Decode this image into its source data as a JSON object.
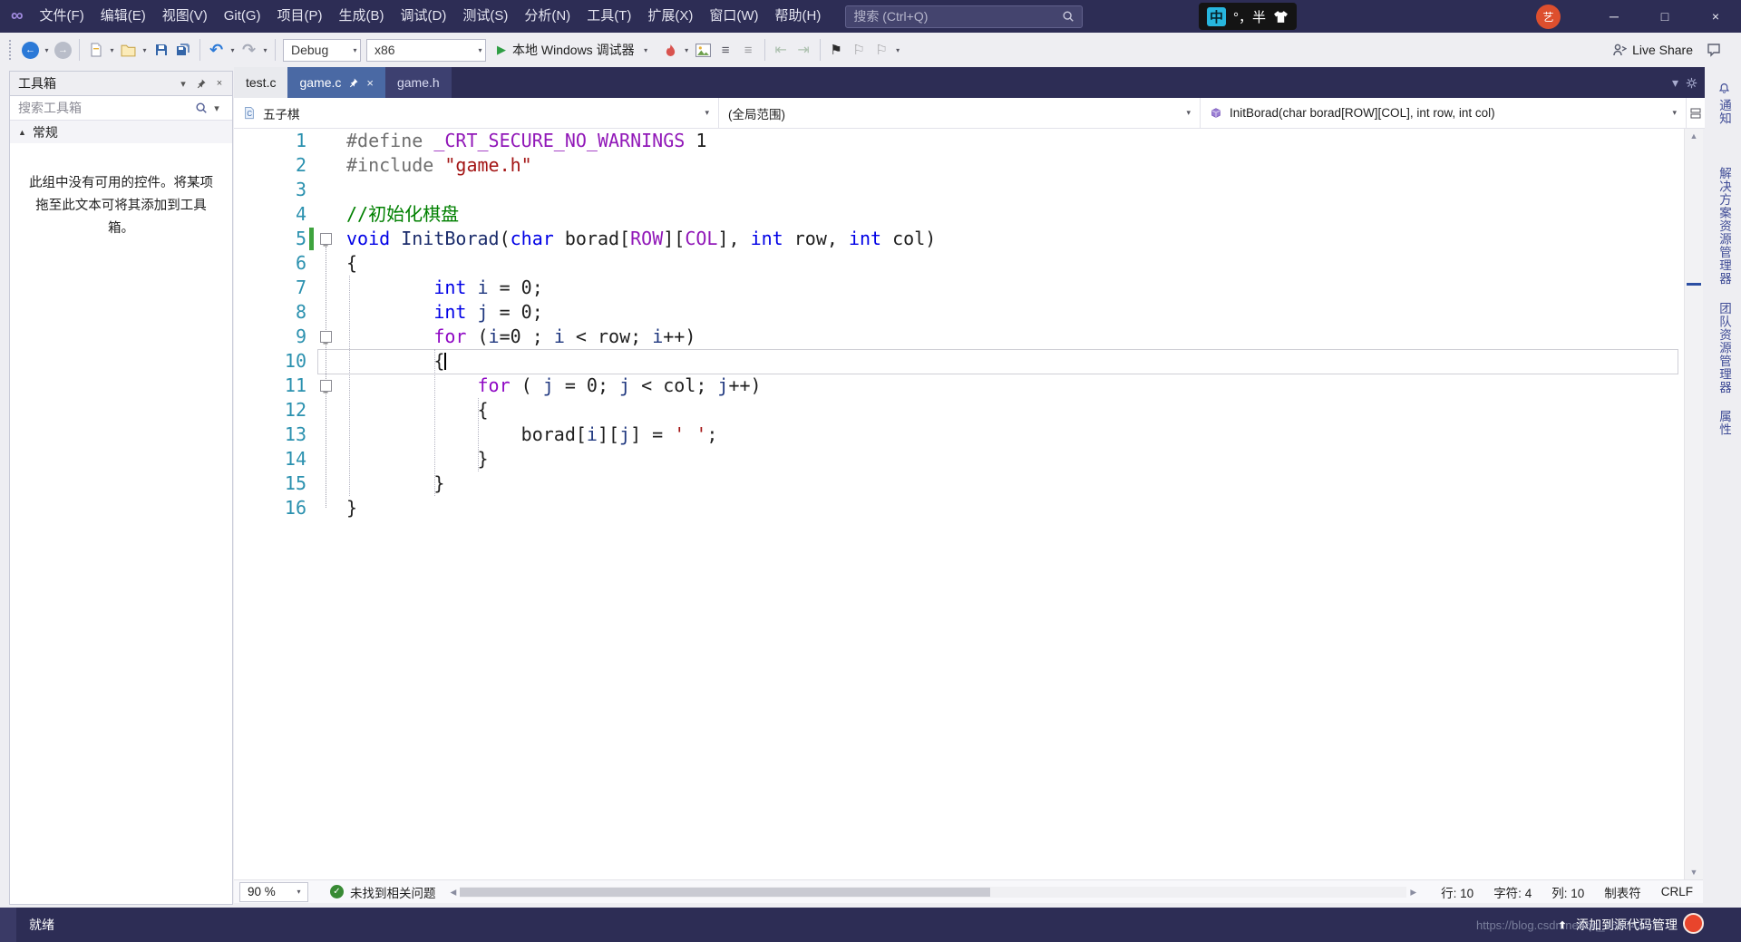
{
  "window": {
    "menu": [
      "文件(F)",
      "编辑(E)",
      "视图(V)",
      "Git(G)",
      "项目(P)",
      "生成(B)",
      "调试(D)",
      "测试(S)",
      "分析(N)",
      "工具(T)",
      "扩展(X)",
      "窗口(W)",
      "帮助(H)"
    ],
    "search_placeholder": "搜索 (Ctrl+Q)",
    "ime_lang": "中",
    "ime_mode": "°，半",
    "avatar": "艺",
    "controls": {
      "min": "─",
      "max": "□",
      "close": "×"
    }
  },
  "glyphs": {
    "dropdown": "▾",
    "back": "←",
    "forward": "→",
    "undo": "↶",
    "redo": "↷",
    "play": "▶",
    "flag": "⚑",
    "flag_light": "⚐",
    "check": "✓",
    "hamburger": "≡",
    "indent_left": "⇤",
    "indent_right": "⇥",
    "up": "▲",
    "down": "▼",
    "left": "◂",
    "right": "▸",
    "close": "×",
    "section_tri": "▲"
  },
  "toolbar": {
    "debug_config": "Debug",
    "platform": "x86",
    "start_label": "本地 Windows 调试器",
    "live_share": "Live Share"
  },
  "toolbox": {
    "title": "工具箱",
    "search_placeholder": "搜索工具箱",
    "section": "常规",
    "empty_text": "此组中没有可用的控件。将某项拖至此文本可将其添加到工具箱。"
  },
  "tabs": [
    {
      "label": "test.c"
    },
    {
      "label": "game.c",
      "active": true
    },
    {
      "label": "game.h"
    }
  ],
  "navbar": {
    "project": "五子棋",
    "scope": "(全局范围)",
    "member": "InitBorad(char borad[ROW][COL], int row, int col)"
  },
  "editor": {
    "current_line": 10,
    "fold_lines": [
      5,
      9,
      11
    ],
    "changed_lines": [
      5
    ],
    "lines": [
      [
        [
          "pp",
          "#define "
        ],
        [
          "macro",
          "_CRT_SECURE_NO_WARNINGS"
        ],
        [
          "plain",
          " 1"
        ]
      ],
      [
        [
          "pp",
          "#include "
        ],
        [
          "str",
          "\"game.h\""
        ]
      ],
      [],
      [
        [
          "com",
          "//初始化棋盘"
        ]
      ],
      [
        [
          "kw",
          "void"
        ],
        [
          "plain",
          " "
        ],
        [
          "fn",
          "InitBorad"
        ],
        [
          "plain",
          "("
        ],
        [
          "kw",
          "char"
        ],
        [
          "plain",
          " borad["
        ],
        [
          "macro",
          "ROW"
        ],
        [
          "plain",
          "]["
        ],
        [
          "macro",
          "COL"
        ],
        [
          "plain",
          "], "
        ],
        [
          "kw",
          "int"
        ],
        [
          "plain",
          " row, "
        ],
        [
          "kw",
          "int"
        ],
        [
          "plain",
          " col)"
        ]
      ],
      [
        [
          "plain",
          "{"
        ]
      ],
      [
        [
          "plain",
          "\t\t"
        ],
        [
          "kw",
          "int"
        ],
        [
          "plain",
          " "
        ],
        [
          "loc",
          "i"
        ],
        [
          "plain",
          " = 0;"
        ]
      ],
      [
        [
          "plain",
          "\t\t"
        ],
        [
          "kw",
          "int"
        ],
        [
          "plain",
          " "
        ],
        [
          "loc",
          "j"
        ],
        [
          "plain",
          " = 0;"
        ]
      ],
      [
        [
          "plain",
          "\t\t"
        ],
        [
          "ctrl",
          "for"
        ],
        [
          "plain",
          " ("
        ],
        [
          "loc",
          "i"
        ],
        [
          "plain",
          "=0 ; "
        ],
        [
          "loc",
          "i"
        ],
        [
          "plain",
          " < row; "
        ],
        [
          "loc",
          "i"
        ],
        [
          "plain",
          "++)"
        ]
      ],
      [
        [
          "plain",
          "\t\t{"
        ]
      ],
      [
        [
          "plain",
          "\t\t\t"
        ],
        [
          "ctrl",
          "for"
        ],
        [
          "plain",
          " ( "
        ],
        [
          "loc",
          "j"
        ],
        [
          "plain",
          " = 0; "
        ],
        [
          "loc",
          "j"
        ],
        [
          "plain",
          " < col; "
        ],
        [
          "loc",
          "j"
        ],
        [
          "plain",
          "++)"
        ]
      ],
      [
        [
          "plain",
          "\t\t\t{"
        ]
      ],
      [
        [
          "plain",
          "\t\t\t\t"
        ],
        [
          "plain",
          "borad["
        ],
        [
          "loc",
          "i"
        ],
        [
          "plain",
          "]["
        ],
        [
          "loc",
          "j"
        ],
        [
          "plain",
          "] = "
        ],
        [
          "str",
          "' '"
        ],
        [
          "plain",
          ";"
        ]
      ],
      [
        [
          "plain",
          "\t\t\t}"
        ]
      ],
      [
        [
          "plain",
          "\t\t}"
        ]
      ],
      [
        [
          "plain",
          "}"
        ]
      ]
    ]
  },
  "editor_status": {
    "zoom": "90 %",
    "health": "未找到相关问题",
    "line": "行: 10",
    "char": "字符: 4",
    "col": "列: 10",
    "tabs_label": "制表符",
    "eol": "CRLF"
  },
  "right_strip": [
    "通知",
    "解决方案资源管理器",
    "团队资源管理器",
    "属性"
  ],
  "statusbar": {
    "ready": "就绪",
    "source_control": "添加到源代码管理",
    "watermark": "https://blog.csdn.net/qq_46874327"
  },
  "colors": {
    "titlebar": "#2D2D55",
    "toolbar_bg": "#EEEEF2",
    "active_tab": "#4A69A4",
    "inactive_tab": "#3D4070",
    "line_number": "#2B91AF",
    "keyword": "#0000E6",
    "control_keyword": "#8F08C4",
    "macro": "#9118B8",
    "string": "#A31515",
    "comment": "#008000",
    "health_green": "#388A34",
    "start_green": "#2F9E44",
    "change_mark_green": "#3EA33E",
    "badge_red": "#E8452C"
  }
}
